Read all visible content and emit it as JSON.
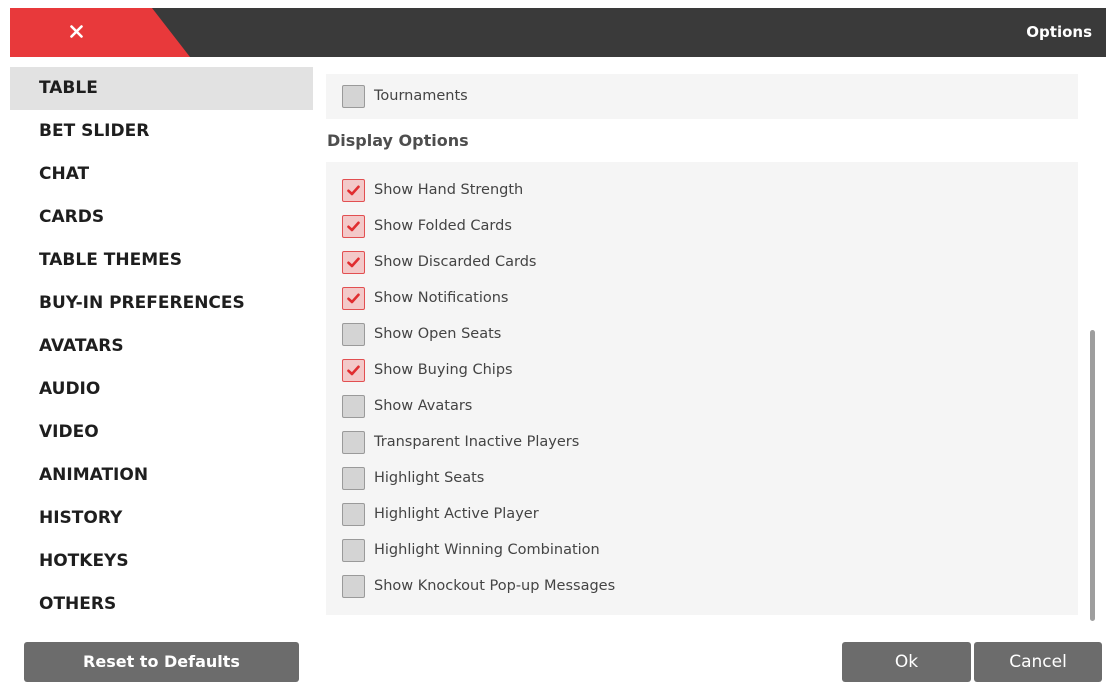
{
  "window": {
    "title": "Options",
    "close_icon": "close-icon"
  },
  "sidebar": {
    "items": [
      {
        "label": "TABLE",
        "active": true
      },
      {
        "label": "BET SLIDER"
      },
      {
        "label": "CHAT"
      },
      {
        "label": "CARDS"
      },
      {
        "label": "TABLE THEMES"
      },
      {
        "label": "BUY-IN PREFERENCES"
      },
      {
        "label": "AVATARS"
      },
      {
        "label": "AUDIO"
      },
      {
        "label": "VIDEO"
      },
      {
        "label": "ANIMATION"
      },
      {
        "label": "HISTORY"
      },
      {
        "label": "HOTKEYS"
      },
      {
        "label": "OTHERS"
      }
    ],
    "reset_label": "Reset to Defaults"
  },
  "content": {
    "top_options": [
      {
        "label": "Tournaments",
        "checked": false
      }
    ],
    "display_heading": "Display Options",
    "display_options": [
      {
        "label": "Show Hand Strength",
        "checked": true
      },
      {
        "label": "Show Folded Cards",
        "checked": true
      },
      {
        "label": "Show Discarded Cards",
        "checked": true
      },
      {
        "label": "Show Notifications",
        "checked": true
      },
      {
        "label": "Show Open Seats",
        "checked": false
      },
      {
        "label": "Show Buying Chips",
        "checked": true
      },
      {
        "label": "Show Avatars",
        "checked": false
      },
      {
        "label": "Transparent Inactive Players",
        "checked": false
      },
      {
        "label": "Highlight Seats",
        "checked": false
      },
      {
        "label": "Highlight Active Player",
        "checked": false
      },
      {
        "label": "Highlight Winning Combination",
        "checked": false
      },
      {
        "label": "Show Knockout Pop-up Messages",
        "checked": false
      }
    ]
  },
  "footer": {
    "ok_label": "Ok",
    "cancel_label": "Cancel"
  },
  "colors": {
    "accent": "#e8393b",
    "titlebar": "#3a3a3a",
    "button": "#6c6c6c",
    "checked_fill": "#f3c9c9",
    "checkmark": "#e02d30"
  }
}
